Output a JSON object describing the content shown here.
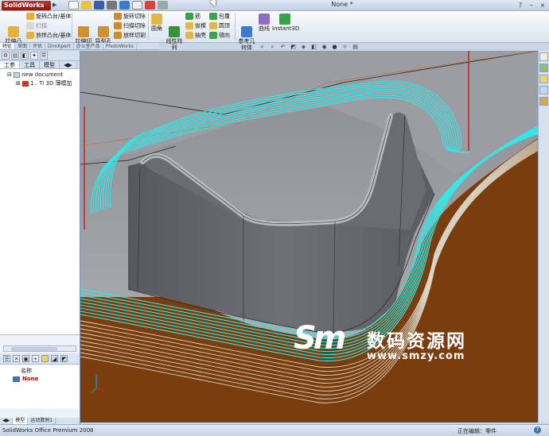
{
  "app": {
    "logo_text": "SolidWorks",
    "document_title": "None *",
    "window_buttons": [
      "?",
      "–",
      "×"
    ]
  },
  "ribbon": {
    "boss_base": "拉伸凸\n台/基体",
    "revolve_boss": "旋转凸台/基体",
    "sweep": "扫描",
    "loft_boss": "放样凸台/基体",
    "extruded_cut": "拉伸切\n除",
    "hole_wizard": "异型孔\n向导",
    "revolve_cut": "旋转切除",
    "swept_cut": "扫描切除",
    "lofted_cut": "放样切割",
    "fillet": "圆角",
    "linear_pattern": "线性阵\n列",
    "rib": "筋",
    "draft": "拔模",
    "shell": "抽壳",
    "wrap": "包覆",
    "dome": "圆顶",
    "mirror": "镜向",
    "reference_geometry": "参考几\n何体",
    "curves": "曲线",
    "instant3d": "Instant3D"
  },
  "command_tabs": [
    "特征",
    "草图",
    "评估",
    "DimXpert",
    "办公室产品",
    "PhotoWorks"
  ],
  "left_panel": {
    "tabs": [
      "工参",
      "工具",
      "模型"
    ],
    "tree": {
      "root": "new document",
      "item": "1 . Ti 3D 薄模加"
    },
    "list_header": "名称",
    "list_item": "None",
    "bottom_tabs": [
      "模型",
      "运动算例1"
    ]
  },
  "watermark": {
    "logo": "Sm",
    "cn": "数码资源网",
    "url": "www.smzy.com"
  },
  "status": {
    "left": "SolidWorks Office Premium 2008",
    "right": "正在编辑：零件",
    "help": "?"
  },
  "colors": {
    "toolpath": "#33e8e8",
    "stock": "#7a3d0e",
    "part": "#6d6d70",
    "background": "#a8a8ac"
  }
}
